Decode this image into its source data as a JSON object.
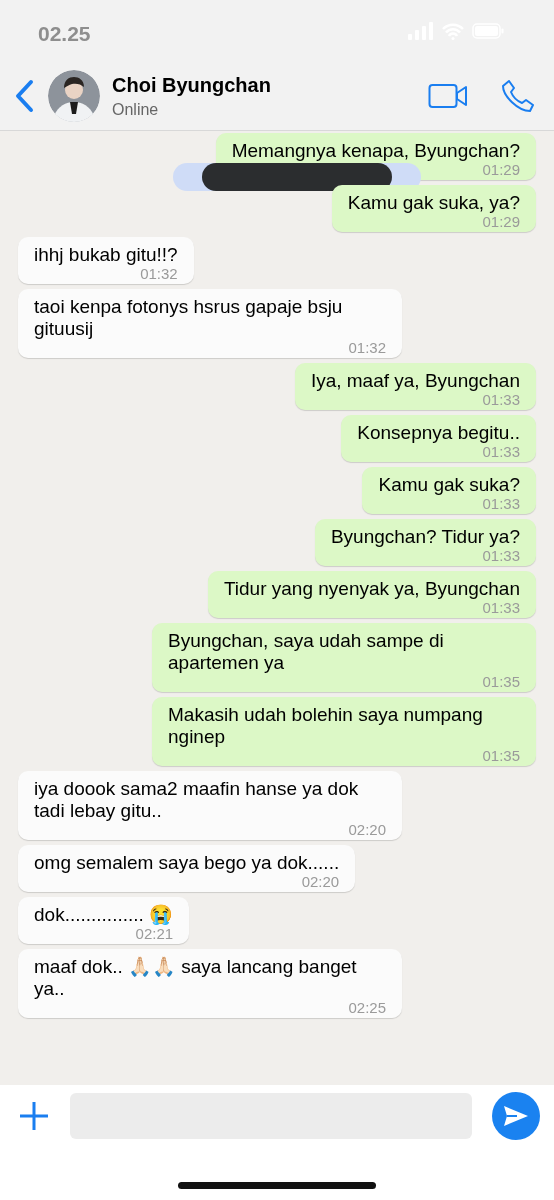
{
  "status_bar": {
    "time": "02.25"
  },
  "header": {
    "name": "Choi Byungchan",
    "status": "Online"
  },
  "messages": [
    {
      "kind": "outgoing",
      "text": "Memangnya kenapa, Byungchan?",
      "time": "01:29",
      "redacted": true
    },
    {
      "kind": "outgoing",
      "text": "Kamu gak suka, ya?",
      "time": "01:29"
    },
    {
      "kind": "incoming",
      "text": "ihhj bukab gitu!!?",
      "time": "01:32"
    },
    {
      "kind": "incoming",
      "text": "taoi kenpa fotonys hsrus gapaje bsju gituusij",
      "time": "01:32"
    },
    {
      "kind": "outgoing",
      "text": "Iya, maaf ya, Byungchan",
      "time": "01:33"
    },
    {
      "kind": "outgoing",
      "text": "Konsepnya begitu..",
      "time": "01:33"
    },
    {
      "kind": "outgoing",
      "text": "Kamu gak suka?",
      "time": "01:33"
    },
    {
      "kind": "outgoing",
      "text": "Byungchan? Tidur ya?",
      "time": "01:33"
    },
    {
      "kind": "outgoing",
      "text": "Tidur yang nyenyak ya, Byungchan",
      "time": "01:33"
    },
    {
      "kind": "outgoing",
      "text": "Byungchan, saya udah sampe di apartemen ya",
      "time": "01:35"
    },
    {
      "kind": "outgoing",
      "text": "Makasih udah bolehin saya numpang nginep",
      "time": "01:35"
    },
    {
      "kind": "incoming",
      "text": "iya doook sama2 maafin hanse ya dok tadi lebay gitu..",
      "time": "02:20"
    },
    {
      "kind": "incoming",
      "text": "omg semalem saya bego ya dok......",
      "time": "02:20"
    },
    {
      "kind": "incoming",
      "text": "dok............... 😭",
      "time": "02:21"
    },
    {
      "kind": "incoming",
      "text": "maaf dok.. 🙏🏻🙏🏻 saya lancang banget ya..",
      "time": "02:25"
    }
  ]
}
